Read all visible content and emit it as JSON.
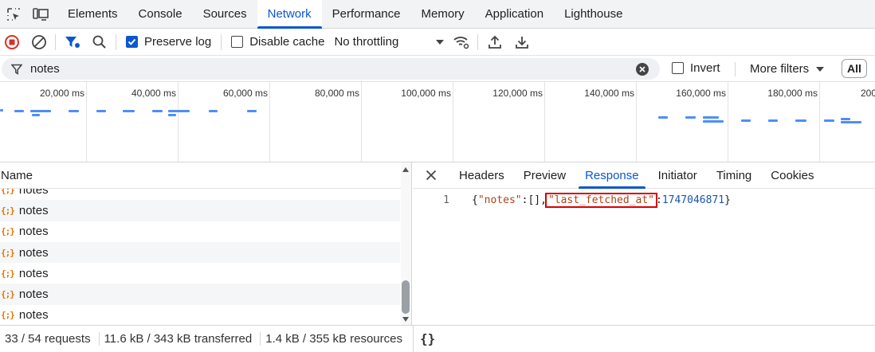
{
  "tabbar": {
    "tabs": [
      {
        "label": "Elements"
      },
      {
        "label": "Console"
      },
      {
        "label": "Sources"
      },
      {
        "label": "Network"
      },
      {
        "label": "Performance"
      },
      {
        "label": "Memory"
      },
      {
        "label": "Application"
      },
      {
        "label": "Lighthouse"
      }
    ],
    "active": "Network"
  },
  "toolbar": {
    "preserve_log": {
      "label": "Preserve log",
      "checked": true
    },
    "disable_cache": {
      "label": "Disable cache",
      "checked": false
    },
    "throttling": "No throttling"
  },
  "filter": {
    "value": "notes",
    "invert_label": "Invert",
    "more_filters_label": "More filters",
    "all_label": "All"
  },
  "timeline": {
    "ticks": [
      "20,000 ms",
      "40,000 ms",
      "60,000 ms",
      "80,000 ms",
      "100,000 ms",
      "120,000 ms",
      "140,000 ms",
      "160,000 ms",
      "180,000 ms",
      "200"
    ]
  },
  "requests": {
    "column_name": "Name",
    "rows": [
      {
        "name": "notes"
      },
      {
        "name": "notes"
      },
      {
        "name": "notes"
      },
      {
        "name": "notes"
      },
      {
        "name": "notes"
      },
      {
        "name": "notes"
      },
      {
        "name": "notes"
      }
    ]
  },
  "detail": {
    "tabs": [
      {
        "label": "Headers"
      },
      {
        "label": "Preview"
      },
      {
        "label": "Response"
      },
      {
        "label": "Initiator"
      },
      {
        "label": "Timing"
      },
      {
        "label": "Cookies"
      }
    ],
    "active": "Response",
    "response": {
      "line_number": "1",
      "open": "{",
      "key1": "\"notes\"",
      "sep1": ":[],",
      "key2": "\"last_fetched_at\"",
      "sep2": ":",
      "value2": "1747046871",
      "close": "}"
    }
  },
  "status": {
    "requests": "33 / 54 requests",
    "transferred": "11.6 kB / 343 kB transferred",
    "resources": "1.4 kB / 355 kB resources",
    "pretty_print": "{}"
  },
  "colors": {
    "accent": "#0b57d0",
    "record_red": "#d93025",
    "highlight_box": "#d90000"
  }
}
